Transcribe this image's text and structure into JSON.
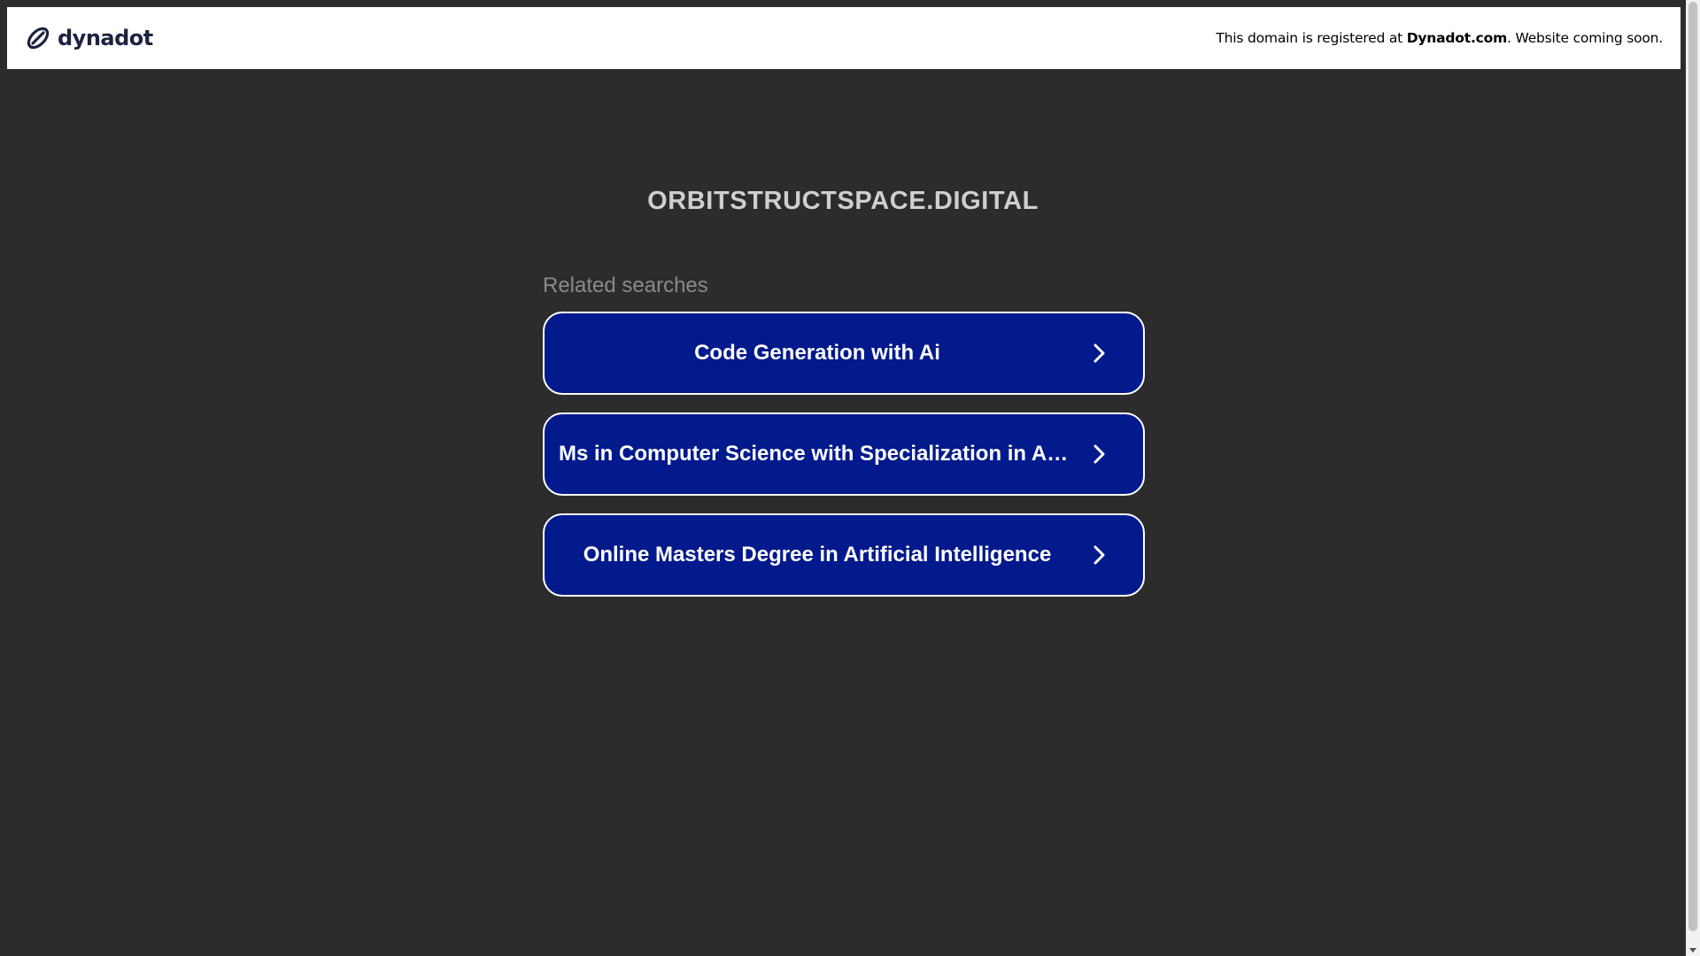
{
  "header": {
    "brand_name": "dynadot",
    "notice_prefix": "This domain is registered at ",
    "notice_link": "Dynadot.com",
    "notice_suffix": ". Website coming soon."
  },
  "main": {
    "domain": "ORBITSTRUCTSPACE.DIGITAL",
    "related_label": "Related searches",
    "searches": [
      {
        "label": "Code Generation with Ai"
      },
      {
        "label": "Ms in Computer Science with Specialization in Artificial Intelligence"
      },
      {
        "label": "Online Masters Degree in Artificial Intelligence"
      }
    ]
  },
  "colors": {
    "page_background": "#2c2c2c",
    "button_background": "#031a8c",
    "brand_text": "#1d2240"
  },
  "icons": {
    "brand": "dynadot-logo-icon",
    "item_arrow": "chevron-right-icon"
  }
}
